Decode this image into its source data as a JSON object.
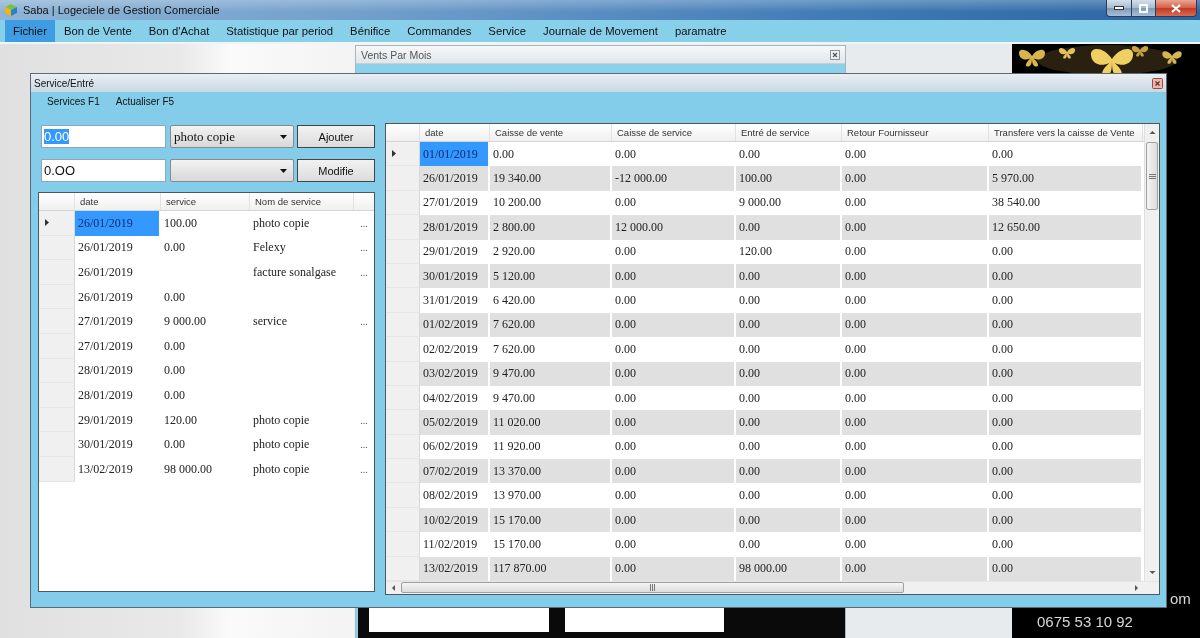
{
  "window": {
    "title": "Saba | Logeciele de Gestion Comerciale"
  },
  "menu": [
    {
      "label": "Fichier",
      "selected": true
    },
    {
      "label": "Bon de Vente",
      "selected": false
    },
    {
      "label": "Bon d'Achat",
      "selected": false
    },
    {
      "label": "Statistique par period",
      "selected": false
    },
    {
      "label": "Bénifice",
      "selected": false
    },
    {
      "label": "Commandes",
      "selected": false
    },
    {
      "label": "Service",
      "selected": false
    },
    {
      "label": "Journale de Movement",
      "selected": false
    },
    {
      "label": "paramatre",
      "selected": false
    }
  ],
  "background_window": {
    "title": "Vents Par Mois"
  },
  "wallpaper": {
    "cut_text": "om",
    "phone": "0675 53 10 92"
  },
  "dialog": {
    "title": "Service/Entré",
    "menu": [
      "Services F1",
      "Actualiser F5"
    ],
    "form": [
      {
        "value": "0.00",
        "text_selected": true,
        "dropdown": "photo copie",
        "button": "Ajouter"
      },
      {
        "value": "0.OO",
        "text_selected": false,
        "button": "Modifie"
      }
    ],
    "services_table": {
      "columns": [
        "date",
        "service",
        "Nom de service"
      ],
      "rows": [
        {
          "selected": true,
          "date": "26/01/2019",
          "service": "100.00",
          "nom_de_service": "photo copie",
          "action": "..."
        },
        {
          "selected": false,
          "date": "26/01/2019",
          "service": "0.00",
          "nom_de_service": "Felexy",
          "action": "..."
        },
        {
          "selected": false,
          "date": "26/01/2019",
          "nom_de_service": "facture sonalgase",
          "action": "..."
        },
        {
          "selected": false,
          "date": "26/01/2019",
          "service": "0.00"
        },
        {
          "selected": false,
          "date": "27/01/2019",
          "service": "9 000.00",
          "nom_de_service": "service",
          "action": "..."
        },
        {
          "selected": false,
          "date": "27/01/2019",
          "service": "0.00"
        },
        {
          "selected": false,
          "date": "28/01/2019",
          "service": "0.00"
        },
        {
          "selected": false,
          "date": "28/01/2019",
          "service": "0.00"
        },
        {
          "selected": false,
          "date": "29/01/2019",
          "service": "120.00",
          "nom_de_service": "photo copie",
          "action": "..."
        },
        {
          "selected": false,
          "date": "30/01/2019",
          "service": "0.00",
          "nom_de_service": "photo copie",
          "action": "..."
        },
        {
          "selected": false,
          "date": "13/02/2019",
          "service": "98 000.00",
          "nom_de_service": "photo copie",
          "action": "..."
        }
      ]
    },
    "cash_table": {
      "columns": [
        "date",
        "Caisse de vente",
        "Caisse de service",
        "Entré de service",
        "Retour Fournisseur",
        "Transfere vers la caisse de Vente"
      ],
      "rows": [
        {
          "selected": true,
          "cells": [
            "01/01/2019",
            "0.00",
            "0.00",
            "0.00",
            "0.00",
            "0.00"
          ]
        },
        {
          "selected": false,
          "cells": [
            "26/01/2019",
            "19 340.00",
            "-12 000.00",
            "100.00",
            "0.00",
            "5 970.00"
          ]
        },
        {
          "selected": false,
          "cells": [
            "27/01/2019",
            "10 200.00",
            "0.00",
            "9 000.00",
            "0.00",
            "38 540.00"
          ]
        },
        {
          "selected": false,
          "cells": [
            "28/01/2019",
            "2 800.00",
            "12 000.00",
            "0.00",
            "0.00",
            "12 650.00"
          ]
        },
        {
          "selected": false,
          "cells": [
            "29/01/2019",
            "2 920.00",
            "0.00",
            "120.00",
            "0.00",
            "0.00"
          ]
        },
        {
          "selected": false,
          "cells": [
            "30/01/2019",
            "5 120.00",
            "0.00",
            "0.00",
            "0.00",
            "0.00"
          ]
        },
        {
          "selected": false,
          "cells": [
            "31/01/2019",
            "6 420.00",
            "0.00",
            "0.00",
            "0.00",
            "0.00"
          ]
        },
        {
          "selected": false,
          "cells": [
            "01/02/2019",
            "7 620.00",
            "0.00",
            "0.00",
            "0.00",
            "0.00"
          ]
        },
        {
          "selected": false,
          "cells": [
            "02/02/2019",
            "7 620.00",
            "0.00",
            "0.00",
            "0.00",
            "0.00"
          ]
        },
        {
          "selected": false,
          "cells": [
            "03/02/2019",
            "9 470.00",
            "0.00",
            "0.00",
            "0.00",
            "0.00"
          ]
        },
        {
          "selected": false,
          "cells": [
            "04/02/2019",
            "9 470.00",
            "0.00",
            "0.00",
            "0.00",
            "0.00"
          ]
        },
        {
          "selected": false,
          "cells": [
            "05/02/2019",
            "11 020.00",
            "0.00",
            "0.00",
            "0.00",
            "0.00"
          ]
        },
        {
          "selected": false,
          "cells": [
            "06/02/2019",
            "11 920.00",
            "0.00",
            "0.00",
            "0.00",
            "0.00"
          ]
        },
        {
          "selected": false,
          "cells": [
            "07/02/2019",
            "13 370.00",
            "0.00",
            "0.00",
            "0.00",
            "0.00"
          ]
        },
        {
          "selected": false,
          "cells": [
            "08/02/2019",
            "13 970.00",
            "0.00",
            "0.00",
            "0.00",
            "0.00"
          ]
        },
        {
          "selected": false,
          "cells": [
            "10/02/2019",
            "15 170.00",
            "0.00",
            "0.00",
            "0.00",
            "0.00"
          ]
        },
        {
          "selected": false,
          "cells": [
            "11/02/2019",
            "15 170.00",
            "0.00",
            "0.00",
            "0.00",
            "0.00"
          ]
        },
        {
          "selected": false,
          "cells": [
            "13/02/2019",
            "117 870.00",
            "0.00",
            "98 000.00",
            "0.00",
            "0.00"
          ]
        }
      ]
    }
  }
}
